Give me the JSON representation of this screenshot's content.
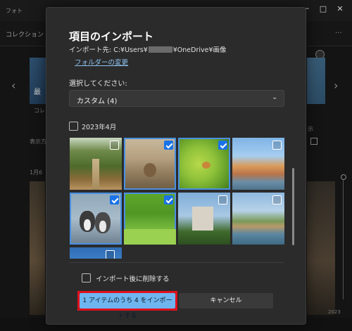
{
  "app": {
    "title": "フォト",
    "window_buttons": {
      "minimize": "─",
      "maximize": "□",
      "close": "✕"
    },
    "tab_label": "コレクション",
    "more": "···",
    "bg_texts": {
      "banner_left": "最",
      "caption_left": "コレ",
      "view_label": "表示方",
      "date_label": "1月6",
      "view_right": "示",
      "year_right": "2023"
    },
    "arrows": {
      "left": "‹",
      "right": "›"
    }
  },
  "dialog": {
    "title": "項目のインポート",
    "destination_prefix": "インポート先: C:¥Users¥",
    "destination_suffix": "¥OneDrive¥画像",
    "change_folder_link": "フォルダーの変更",
    "select_label": "選択してください:",
    "dropdown_value": "カスタム (4)",
    "dropdown_icon": "chevron-down-icon",
    "group_label": "2023年4月",
    "thumbnails": [
      {
        "id": "forest-path",
        "selected": false
      },
      {
        "id": "otter",
        "selected": true
      },
      {
        "id": "bird",
        "selected": true
      },
      {
        "id": "venice",
        "selected": false
      },
      {
        "id": "penguins",
        "selected": true
      },
      {
        "id": "park",
        "selected": true
      },
      {
        "id": "castle",
        "selected": false
      },
      {
        "id": "canal",
        "selected": false
      },
      {
        "id": "partial-blue",
        "selected": false
      }
    ],
    "delete_after_import_label": "インポート後に削除する",
    "import_button": "1 アイテムのうち 4 をインポートする",
    "cancel_button": "キャンセル"
  },
  "colors": {
    "accent": "#6fb6f0",
    "highlight": "#e0101c",
    "dialog_bg": "#2b2b2b"
  }
}
